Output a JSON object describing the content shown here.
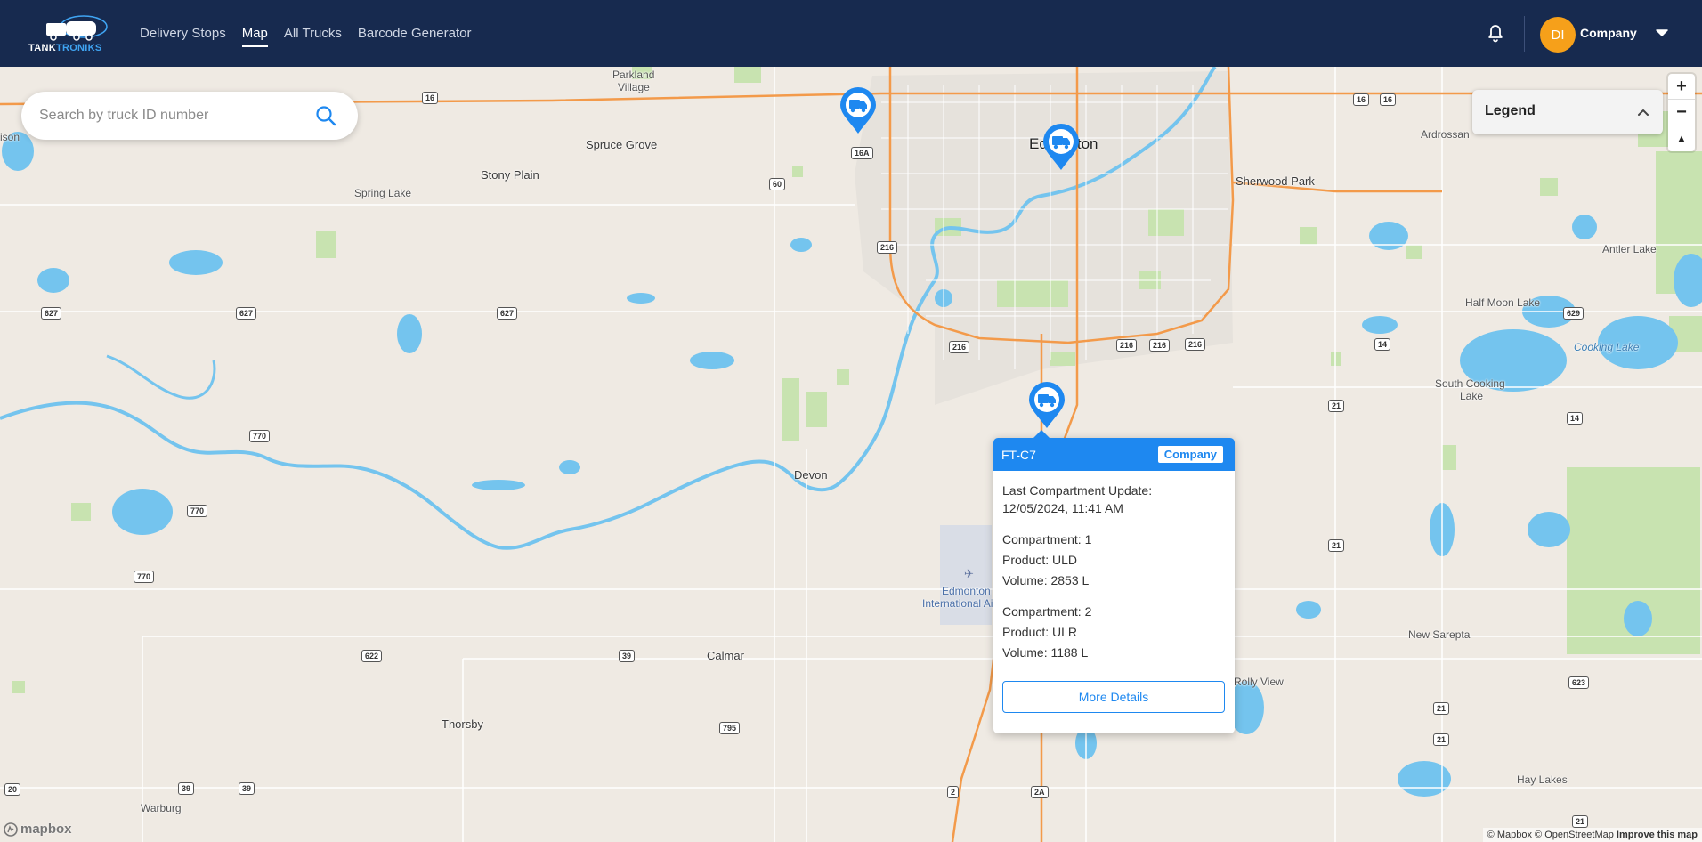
{
  "brand": {
    "name_part1": "TANK",
    "name_part2": "TRONIKS"
  },
  "nav": {
    "items": [
      {
        "label": "Delivery Stops"
      },
      {
        "label": "Map",
        "active": true
      },
      {
        "label": "All Trucks"
      },
      {
        "label": "Barcode Generator"
      }
    ]
  },
  "user": {
    "initials": "DI",
    "company": "Company"
  },
  "search": {
    "placeholder": "Search by truck ID number"
  },
  "legend": {
    "title": "Legend"
  },
  "zoom": {
    "in": "+",
    "out": "−",
    "compass": "▲"
  },
  "popup": {
    "truck_id": "FT-C7",
    "company": "Company",
    "last_update_label": "Last Compartment Update:",
    "last_update_value": "12/05/2024, 11:41 AM",
    "compartments": [
      {
        "compartment": "Compartment: 1",
        "product": "Product: ULD",
        "volume": "Volume: 2853 L"
      },
      {
        "compartment": "Compartment: 2",
        "product": "Product: ULR",
        "volume": "Volume: 1188 L"
      }
    ],
    "button": "More Details"
  },
  "places": {
    "parkland_village_1": "Parkland",
    "parkland_village_2": "Village",
    "spruce_grove": "Spruce Grove",
    "stony_plain": "Stony Plain",
    "spring_lake": "Spring Lake",
    "edmonton": "Edmonton",
    "sherwood_park": "Sherwood Park",
    "ardrossan": "Ardrossan",
    "antler_lake": "Antler Lake",
    "half_moon_lake": "Half Moon Lake",
    "cooking_lake": "Cooking Lake",
    "south_cooking_lake_1": "South Cooking",
    "south_cooking_lake_2": "Lake",
    "devon": "Devon",
    "calmar": "Calmar",
    "thorsby": "Thorsby",
    "warburg": "Warburg",
    "new_sarepta": "New Sarepta",
    "rolly_view": "Rolly View",
    "hay_lakes": "Hay Lakes",
    "airport_1": "Edmonton",
    "airport_2": "International Ai",
    "edge_left": "ison"
  },
  "highways": [
    "16",
    "16",
    "16",
    "16A",
    "60",
    "216",
    "627",
    "627",
    "627",
    "216",
    "216",
    "216",
    "216",
    "629",
    "14",
    "21",
    "14",
    "770",
    "770",
    "770",
    "21",
    "622",
    "39",
    "795",
    "623",
    "21",
    "21",
    "20",
    "39",
    "39",
    "2",
    "2A",
    "21"
  ],
  "attribution": {
    "mapbox": "© Mapbox",
    "osm": "© OpenStreetMap",
    "improve": "Improve this map"
  },
  "mapbox_logo": "mapbox",
  "colors": {
    "nav_bg": "#172a4f",
    "accent_blue": "#1e88f0",
    "avatar": "#f6a01a",
    "water": "#74c4ee",
    "major_road": "#f39a4a"
  }
}
